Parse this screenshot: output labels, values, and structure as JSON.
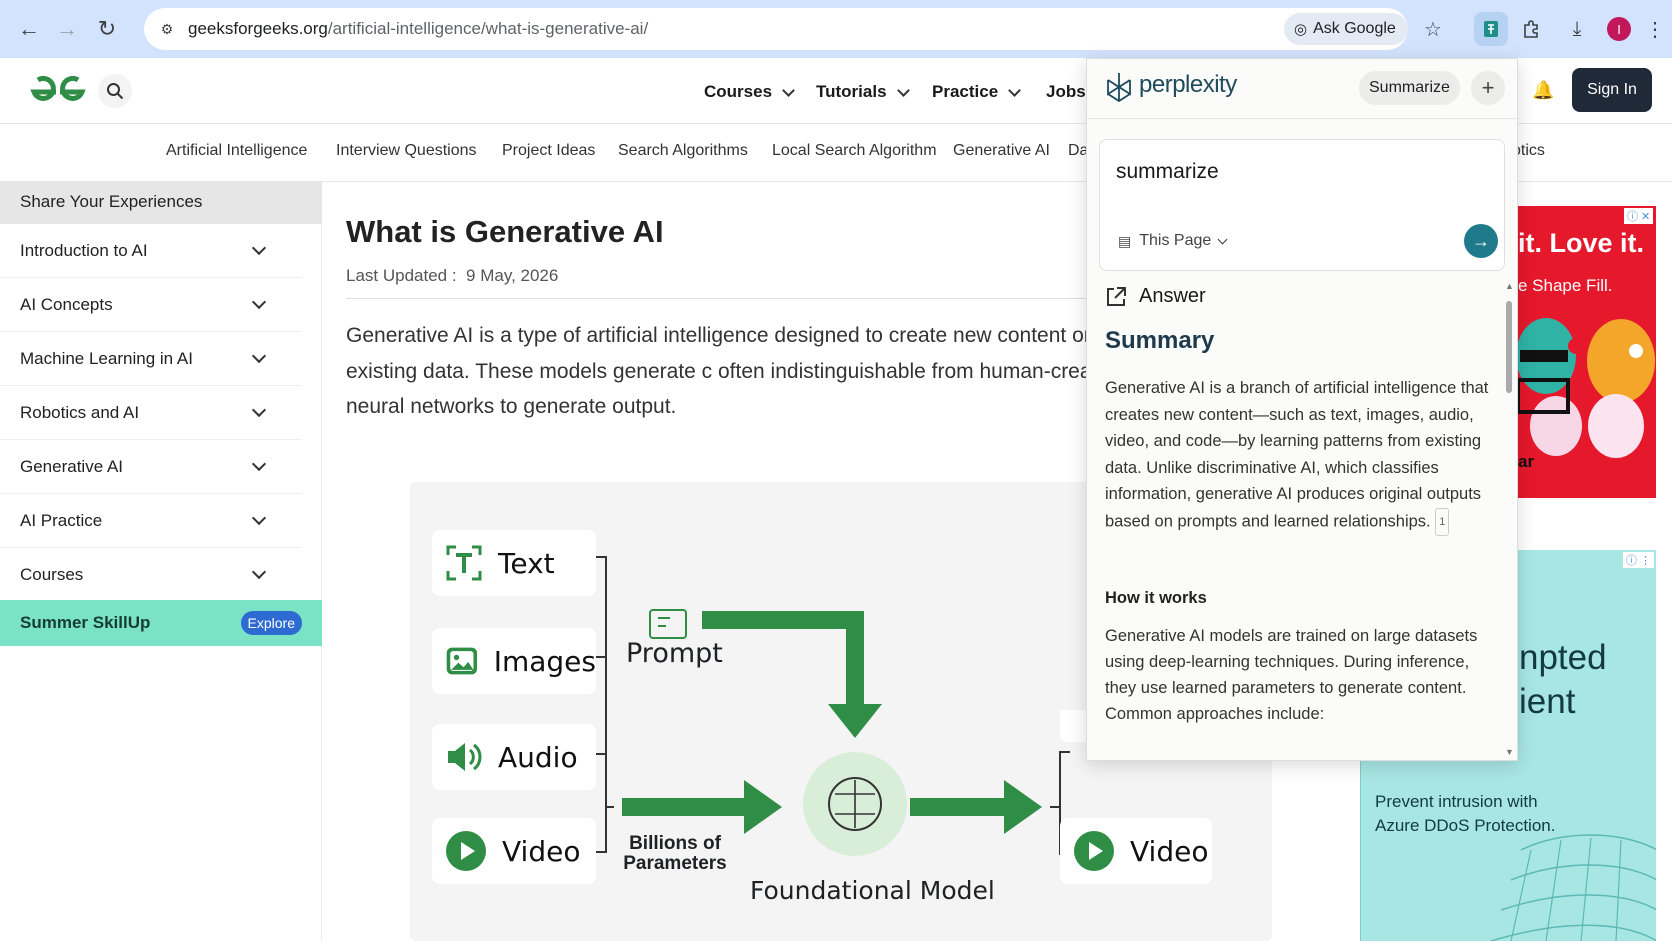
{
  "browser": {
    "url_domain": "geeksforgeeks.org",
    "url_path": "/artificial-intelligence/what-is-generative-ai/",
    "ask_google_label": "Ask Google",
    "profile_initial": "I"
  },
  "gfg_header": {
    "menu": [
      "Courses",
      "Tutorials",
      "Practice",
      "Jobs"
    ],
    "sign_in_label": "Sign In"
  },
  "subnav": {
    "items": [
      "Artificial Intelligence",
      "Interview Questions",
      "Project Ideas",
      "Search Algorithms",
      "Local Search Algorithm",
      "Generative AI",
      "Da",
      "otics"
    ]
  },
  "sidebar": {
    "share_label": "Share Your Experiences",
    "items": [
      "Introduction to AI",
      "AI Concepts",
      "Machine Learning in AI",
      "Robotics and AI",
      "Generative AI",
      "AI Practice",
      "Courses"
    ],
    "promo_label": "Summer SkillUp",
    "promo_badge": "Explore"
  },
  "article": {
    "title": "What is Generative AI",
    "updated_label": "Last Updated :",
    "updated_date": "9 May, 2026",
    "paragraph": "Generative AI is a type of artificial intelligence designed to create new content or even code by learning patterns from existing data. These models generate c often indistinguishable from human-created content. These models use techni neural networks to generate output."
  },
  "diagram": {
    "inputs": [
      "Text",
      "Images",
      "Audio",
      "Video"
    ],
    "prompt_label": "Prompt",
    "params_label_1": "Billions of",
    "params_label_2": "Parameters",
    "model_label": "Foundational Model",
    "output_label": "Video"
  },
  "ads": {
    "ad1_line1": "it. Love it.",
    "ad1_line2": "e Shape Fill.",
    "ad1_fragment": "ar",
    "ad2_line1": "npted",
    "ad2_line2": "ient",
    "ad2_body": "Prevent intrusion with Azure DDoS Protection."
  },
  "perplexity": {
    "brand": "perplexity",
    "summarize_label": "Summarize",
    "query": "summarize",
    "scope_label": "This Page",
    "answer_label": "Answer",
    "summary_heading": "Summary",
    "summary_text": "Generative AI is a branch of artificial intelligence that creates new content—such as text, images, audio, video, and code—by learning patterns from existing data. Unlike discriminative AI, which classifies information, generative AI produces original outputs based on prompts and learned relationships.",
    "citation": "1",
    "how_heading": "How it works",
    "how_text": "Generative AI models are trained on large datasets using deep-learning techniques. During inference, they use learned parameters to generate content. Common approaches include:"
  },
  "colors": {
    "gfg_green": "#2f8d46",
    "chrome_bar": "#d3e3fd",
    "perplexity_teal": "#1f7a8c",
    "skillup_bg": "#7ae3c5"
  }
}
